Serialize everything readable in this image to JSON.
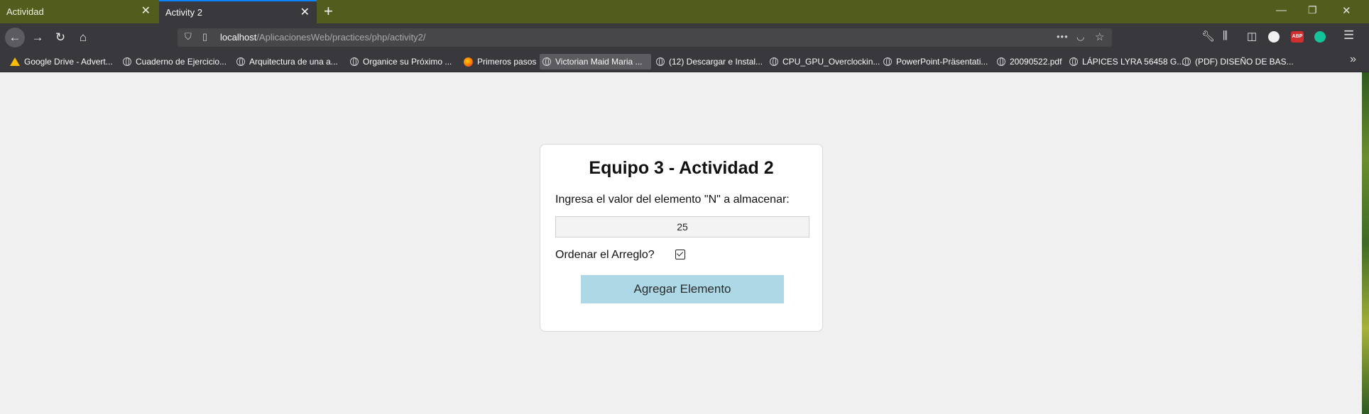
{
  "browser": {
    "tabs": [
      {
        "label": "Actividad"
      },
      {
        "label": "Activity 2"
      }
    ],
    "url": {
      "host": "localhost",
      "path": "/AplicacionesWeb/practices/php/activity2/"
    },
    "bookmarks": [
      {
        "label": "Google Drive - Advert...",
        "icon": "google-drive-icon"
      },
      {
        "label": "Cuaderno de Ejercicio...",
        "icon": "globe-icon"
      },
      {
        "label": "Arquitectura de una a...",
        "icon": "globe-icon"
      },
      {
        "label": "Organice su Próximo ...",
        "icon": "globe-icon"
      },
      {
        "label": "Primeros pasos",
        "icon": "firefox-icon"
      },
      {
        "label": "Victorian Maid Maria ...",
        "icon": "globe-icon"
      },
      {
        "label": "(12) Descargar e Instal...",
        "icon": "globe-icon"
      },
      {
        "label": "CPU_GPU_Overclockin...",
        "icon": "globe-icon"
      },
      {
        "label": "PowerPoint-Präsentati...",
        "icon": "globe-icon"
      },
      {
        "label": "20090522.pdf",
        "icon": "globe-icon"
      },
      {
        "label": "LÁPICES LYRA 56458 G...",
        "icon": "globe-icon"
      },
      {
        "label": "(PDF) DISEÑO DE BAS...",
        "icon": "globe-icon"
      }
    ],
    "colors": {
      "tab_strip": "#525d1d",
      "toolbar": "#38383d",
      "active_tab_line": "#0a84ff"
    }
  },
  "page": {
    "title": "Equipo 3 - Actividad 2",
    "input_label": "Ingresa el valor del elemento \"N\" a almacenar:",
    "input_value": "25",
    "checkbox_label": "Ordenar el Arreglo?",
    "checkbox_checked": true,
    "submit_label": "Agregar Elemento",
    "colors": {
      "button": "#add8e6",
      "background": "#f0f0f0"
    }
  }
}
